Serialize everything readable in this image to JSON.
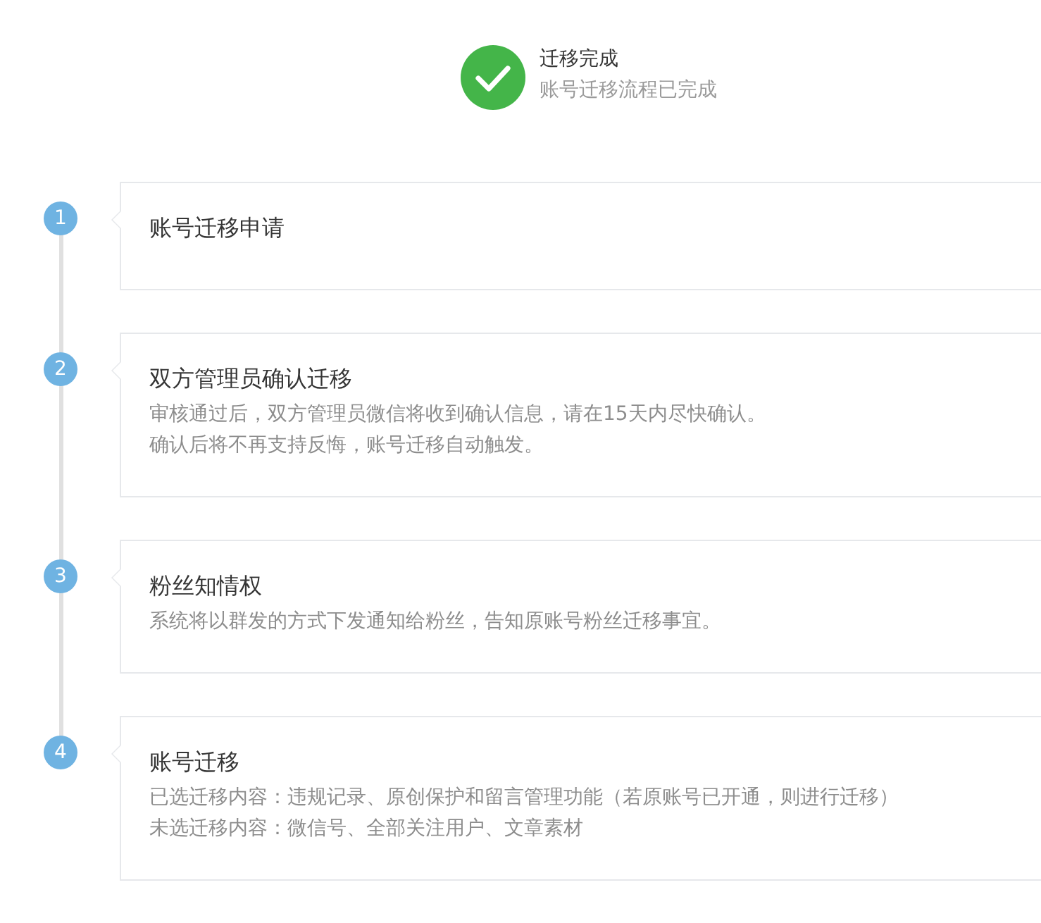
{
  "status": {
    "title": "迁移完成",
    "subtitle": "账号迁移流程已完成"
  },
  "steps": [
    {
      "number": "1",
      "title": "账号迁移申请"
    },
    {
      "number": "2",
      "title": "双方管理员确认迁移",
      "lines": [
        "审核通过后，双方管理员微信将收到确认信息，请在15天内尽快确认。",
        "确认后将不再支持反悔，账号迁移自动触发。"
      ]
    },
    {
      "number": "3",
      "title": "粉丝知情权",
      "lines": [
        "系统将以群发的方式下发通知给粉丝，告知原账号粉丝迁移事宜。"
      ]
    },
    {
      "number": "4",
      "title": "账号迁移",
      "lines": [
        "已选迁移内容：违规记录、原创保护和留言管理功能（若原账号已开通，则进行迁移）",
        "未选迁移内容：微信号、全部关注用户、文章素材"
      ]
    }
  ]
}
